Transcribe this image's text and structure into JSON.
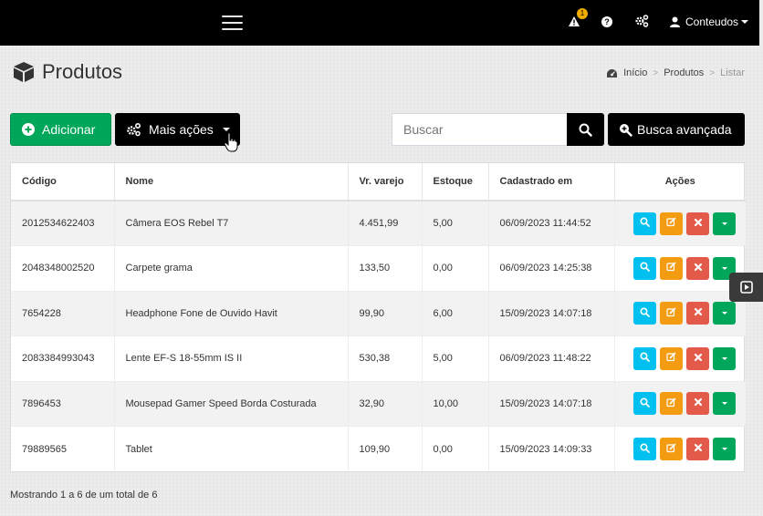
{
  "topbar": {
    "notification_count": "1",
    "help_glyph": "?",
    "user_label": "Conteudos"
  },
  "page": {
    "title": "Produtos",
    "icon": "cube-icon"
  },
  "breadcrumb": {
    "items": [
      "Início",
      "Produtos",
      "Listar"
    ],
    "separator": ">"
  },
  "toolbar": {
    "add_label": "Adicionar",
    "more_label": "Mais ações",
    "search_placeholder": "Buscar",
    "advanced_label": "Busca avançada"
  },
  "table": {
    "headers": [
      "Código",
      "Nome",
      "Vr. varejo",
      "Estoque",
      "Cadastrado em",
      "Ações"
    ],
    "rows": [
      [
        "2012534622403",
        "Câmera EOS Rebel T7",
        "4.451,99",
        "5,00",
        "06/09/2023 11:44:52"
      ],
      [
        "2048348002520",
        "Carpete grama",
        "133,50",
        "0,00",
        "06/09/2023 14:25:38"
      ],
      [
        "7654228",
        "Headphone Fone de Ouvido Havit",
        "99,90",
        "6,00",
        "15/09/2023 14:07:18"
      ],
      [
        "2083384993043",
        "Lente EF-S 18-55mm IS II",
        "530,38",
        "5,00",
        "06/09/2023 11:48:22"
      ],
      [
        "7896453",
        "Mousepad Gamer Speed Borda Costurada",
        "32,90",
        "10,00",
        "15/09/2023 14:07:18"
      ],
      [
        "79889565",
        "Tablet",
        "109,90",
        "0,00",
        "15/09/2023 14:09:33"
      ]
    ]
  },
  "footer": {
    "summary": "Mostrando 1 a 6 de um total de 6"
  },
  "colors": {
    "topbar": "#000000",
    "add_button": "#00a65a",
    "view_button": "#00c0ef",
    "edit_button": "#f39c12",
    "delete_button": "#e35a4a",
    "more_button": "#00a65a",
    "badge": "#f0ad00"
  }
}
